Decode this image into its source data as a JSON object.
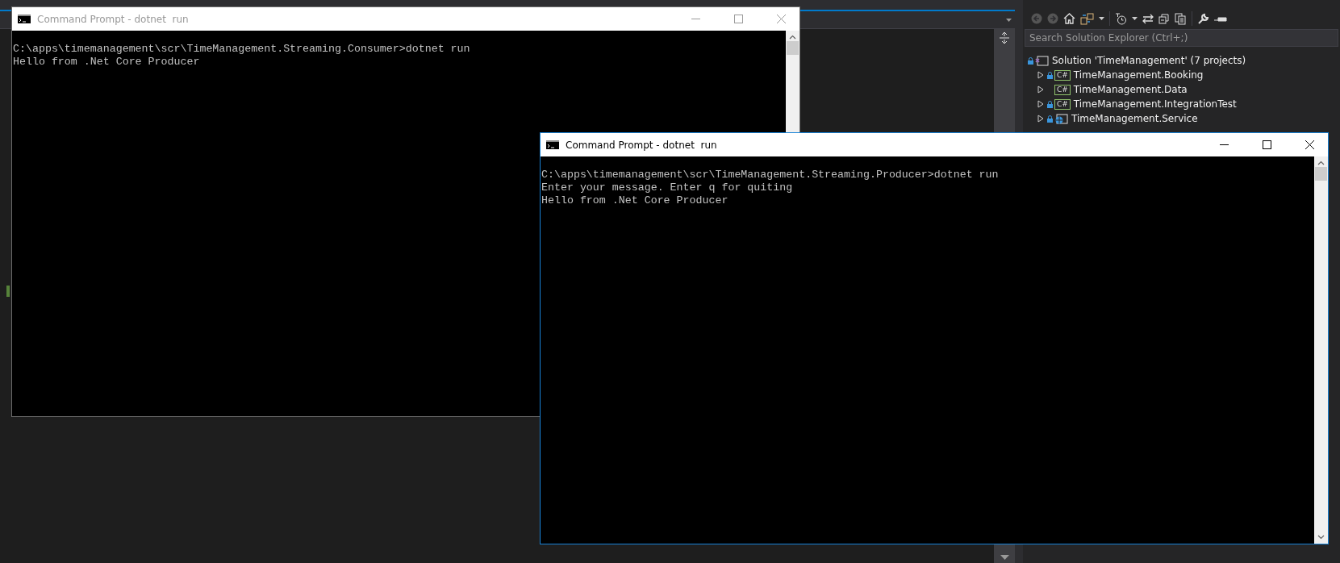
{
  "consoles": [
    {
      "title": "Command Prompt - dotnet  run",
      "active": false,
      "lines": [
        "C:\\apps\\timemanagement\\scr\\TimeManagement.Streaming.Consumer>dotnet run",
        "Hello from .Net Core Producer"
      ]
    },
    {
      "title": "Command Prompt - dotnet  run",
      "active": true,
      "lines": [
        "C:\\apps\\timemanagement\\scr\\TimeManagement.Streaming.Producer>dotnet run",
        "Enter your message. Enter q for quiting",
        "Hello from .Net Core Producer"
      ]
    }
  ],
  "solution_explorer": {
    "search": {
      "placeholder": "Search Solution Explorer (Ctrl+;)"
    },
    "tree": [
      {
        "label": "Solution 'TimeManagement' (7 projects)",
        "kind": "solution",
        "locked": true,
        "children": [
          {
            "label": "TimeManagement.Booking",
            "kind": "csharp",
            "icon_text": "C#",
            "locked": true,
            "expanded": false
          },
          {
            "label": "TimeManagement.Data",
            "kind": "csharp",
            "icon_text": "C#",
            "locked": false,
            "expanded": false
          },
          {
            "label": "TimeManagement.IntegrationTest",
            "kind": "csharp",
            "icon_text": "C#",
            "locked": true,
            "expanded": false
          },
          {
            "label": "TimeManagement.Service",
            "kind": "web",
            "locked": true,
            "expanded": false
          }
        ]
      }
    ]
  }
}
